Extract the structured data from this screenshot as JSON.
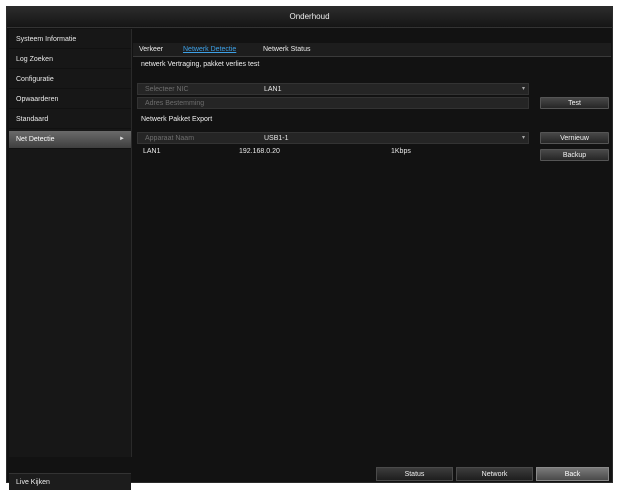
{
  "window": {
    "title": "Onderhoud"
  },
  "sidebar": {
    "items": [
      {
        "label": "Systeem Informatie",
        "active": false
      },
      {
        "label": "Log Zoeken",
        "active": false
      },
      {
        "label": "Configuratie",
        "active": false
      },
      {
        "label": "Opwaarderen",
        "active": false
      },
      {
        "label": "Standaard",
        "active": false
      },
      {
        "label": "Net Detectie",
        "active": true,
        "arrow": "►"
      }
    ],
    "live_view": "Live Kijken"
  },
  "tabs": [
    {
      "label": "Verkeer",
      "active": false
    },
    {
      "label": "Netwerk Detectie",
      "active": true
    },
    {
      "label": "Netwerk Status",
      "active": false
    }
  ],
  "delay_test": {
    "heading": "netwerk Vertraging, pakket verlies test",
    "nic_placeholder": "Selecteer NIC",
    "nic_value": "LAN1",
    "address_placeholder": "Adres Bestemming",
    "test_button": "Test"
  },
  "packet_export": {
    "heading": "Netwerk Pakket Export",
    "device_placeholder": "Apparaat Naam",
    "device_value": "USB1-1",
    "refresh_button": "Vernieuw",
    "backup_button": "Backup",
    "row": {
      "interface": "LAN1",
      "ip": "192.168.0.20",
      "rate": "1Kbps"
    }
  },
  "footer": {
    "status_button": "Status",
    "network_button": "Network",
    "back_button": "Back"
  },
  "colors": {
    "accent": "#3da0e6",
    "background": "#121212"
  },
  "icons": {
    "dropdown": "chevron-down-icon",
    "submenu": "chevron-right-icon"
  }
}
